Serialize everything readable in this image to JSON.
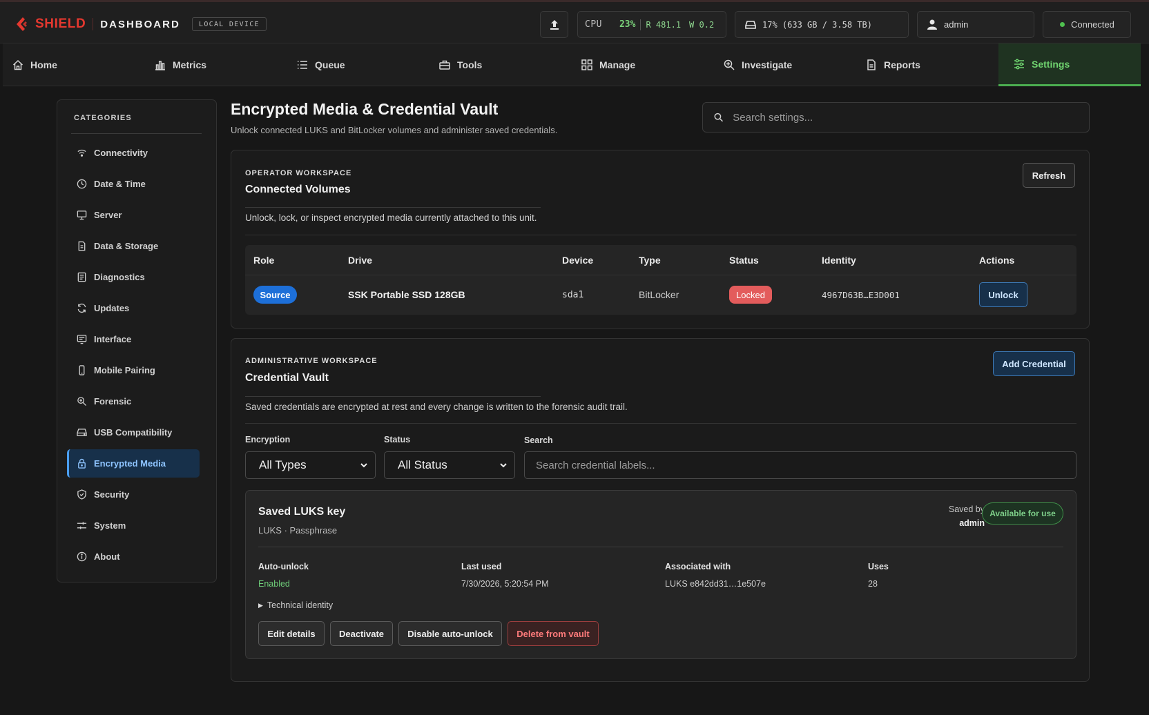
{
  "header": {
    "brand_name": "SHIELD",
    "brand_section": "DASHBOARD",
    "device_badge": "LOCAL DEVICE",
    "cpu_label": "CPU",
    "cpu_percent": "23%",
    "read_rate": "R 481.1",
    "write_rate": "W 0.2",
    "disk_usage": "17% (633 GB / 3.58 TB)",
    "user": "admin",
    "connection_status": "Connected"
  },
  "nav": {
    "items": [
      {
        "label": "Home",
        "icon": "home-icon"
      },
      {
        "label": "Metrics",
        "icon": "bar-chart-icon"
      },
      {
        "label": "Queue",
        "icon": "list-icon"
      },
      {
        "label": "Tools",
        "icon": "toolbox-icon"
      },
      {
        "label": "Manage",
        "icon": "grid-icon"
      },
      {
        "label": "Investigate",
        "icon": "magnify-icon"
      },
      {
        "label": "Reports",
        "icon": "document-icon"
      },
      {
        "label": "Settings",
        "icon": "sliders-icon"
      }
    ],
    "active": "Settings"
  },
  "sidebar": {
    "title": "CATEGORIES",
    "items": [
      {
        "label": "Connectivity",
        "icon": "wifi-icon"
      },
      {
        "label": "Date & Time",
        "icon": "clock-icon"
      },
      {
        "label": "Server",
        "icon": "monitor-icon"
      },
      {
        "label": "Data & Storage",
        "icon": "file-icon"
      },
      {
        "label": "Diagnostics",
        "icon": "log-icon"
      },
      {
        "label": "Updates",
        "icon": "refresh-icon"
      },
      {
        "label": "Interface",
        "icon": "display-icon"
      },
      {
        "label": "Mobile Pairing",
        "icon": "phone-icon"
      },
      {
        "label": "Forensic",
        "icon": "zoom-icon"
      },
      {
        "label": "USB Compatibility",
        "icon": "drive-icon"
      },
      {
        "label": "Encrypted Media",
        "icon": "lock-icon"
      },
      {
        "label": "Security",
        "icon": "shield-icon"
      },
      {
        "label": "System",
        "icon": "sliders-icon"
      },
      {
        "label": "About",
        "icon": "info-icon"
      }
    ],
    "active": "Encrypted Media"
  },
  "page": {
    "title": "Encrypted Media & Credential Vault",
    "subtitle": "Unlock connected LUKS and BitLocker volumes and administer saved credentials.",
    "search_placeholder": "Search settings..."
  },
  "volumes": {
    "eyebrow": "OPERATOR WORKSPACE",
    "title": "Connected Volumes",
    "description": "Unlock, lock, or inspect encrypted media currently attached to this unit.",
    "refresh_label": "Refresh",
    "columns": [
      "Role",
      "Drive",
      "Device",
      "Type",
      "Status",
      "Identity",
      "Actions"
    ],
    "rows": [
      {
        "role": "Source",
        "drive": "SSK Portable SSD 128GB",
        "device": "sda1",
        "type": "BitLocker",
        "status": "Locked",
        "identity": "4967D63B…E3D001",
        "action": "Unlock"
      }
    ]
  },
  "vault": {
    "eyebrow": "ADMINISTRATIVE WORKSPACE",
    "title": "Credential Vault",
    "description": "Saved credentials are encrypted at rest and every change is written to the forensic audit trail.",
    "add_label": "Add Credential",
    "filters": {
      "encryption_label": "Encryption",
      "encryption_value": "All Types",
      "status_label": "Status",
      "status_value": "All Status",
      "search_label": "Search",
      "search_placeholder": "Search credential labels..."
    },
    "credential": {
      "title": "Saved LUKS key",
      "meta": "LUKS · Passphrase",
      "saved_by_label": "Saved by",
      "saved_by": "admin",
      "availability": "Available for use",
      "fields": [
        {
          "label": "Auto-unlock",
          "value": "Enabled"
        },
        {
          "label": "Last used",
          "value": "7/30/2026, 5:20:54 PM"
        },
        {
          "label": "Associated with",
          "value": "LUKS e842dd31…1e507e"
        },
        {
          "label": "Uses",
          "value": "28"
        }
      ],
      "technical_identity": "Technical identity",
      "actions": [
        "Edit details",
        "Deactivate",
        "Disable auto-unlock",
        "Delete from vault"
      ]
    }
  },
  "colors": {
    "brand_red": "#e5382f",
    "accent_green": "#4caf50",
    "accent_blue": "#4a9ef0",
    "danger": "#e35c5c"
  }
}
